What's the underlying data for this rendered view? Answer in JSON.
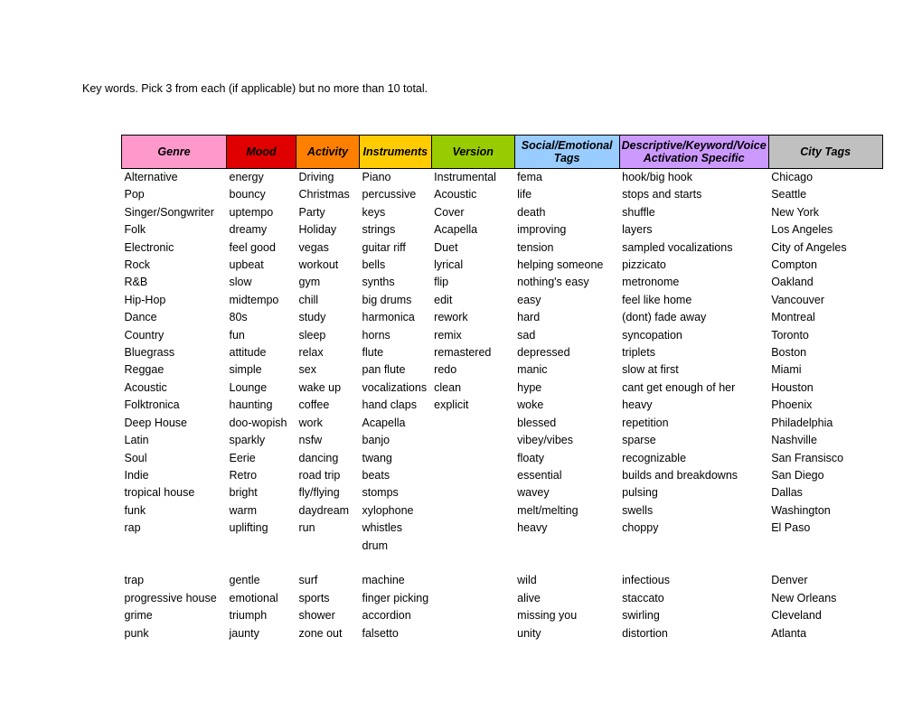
{
  "intro": {
    "text": "Key words. Pick 3 from each (if applicable) but no more than 10 total."
  },
  "table": {
    "headers": [
      {
        "label": "Genre",
        "color": "#FF99CC"
      },
      {
        "label": "Mood",
        "color": "#E00000"
      },
      {
        "label": "Activity",
        "color": "#FF8000"
      },
      {
        "label": "Instruments",
        "color": "#FFCC00"
      },
      {
        "label": "Version",
        "color": "#99CC00"
      },
      {
        "label": "Social/Emotional Tags",
        "color": "#99CCFF"
      },
      {
        "label": "Descriptive/Keyword/Voice Activation Specific",
        "color": "#CC99FF"
      },
      {
        "label": "City Tags",
        "color": "#C0C0C0"
      }
    ],
    "columns": {
      "genre": [
        "Alternative",
        "Pop",
        "Singer/Songwriter",
        "Folk",
        "Electronic",
        "Rock",
        "R&B",
        "Hip-Hop",
        "Dance",
        "Country",
        "Bluegrass",
        "Reggae",
        "Acoustic",
        "Folktronica",
        "Deep House",
        "Latin",
        "Soul",
        "Indie",
        "tropical house",
        "funk",
        "rap",
        "",
        "",
        "trap",
        "progressive house",
        "grime",
        "punk"
      ],
      "mood": [
        "energy",
        "bouncy",
        "uptempo",
        "dreamy",
        "feel good",
        "upbeat",
        "slow",
        "midtempo",
        "80s",
        "fun",
        "attitude",
        "simple",
        "Lounge",
        "haunting",
        "doo-wopish",
        "sparkly",
        "Eerie",
        "Retro",
        "bright",
        "warm",
        "uplifting",
        "",
        "",
        "gentle",
        "emotional",
        "triumph",
        "jaunty"
      ],
      "activity": [
        "Driving",
        "Christmas",
        "Party",
        "Holiday",
        "vegas",
        "workout",
        "gym",
        "chill",
        "study",
        "sleep",
        "relax",
        "sex",
        "wake up",
        "coffee",
        "work",
        "nsfw",
        "dancing",
        "road trip",
        "fly/flying",
        "daydream",
        "run",
        "",
        "",
        "surf",
        "sports",
        "shower",
        "zone out"
      ],
      "instruments": [
        "Piano",
        "percussive",
        "keys",
        "strings",
        "guitar riff",
        "bells",
        "synths",
        "big drums",
        "harmonica",
        "horns",
        "flute",
        "pan flute",
        "vocalizations",
        "hand claps",
        "Acapella",
        "banjo",
        "twang",
        "beats",
        "stomps",
        "xylophone",
        "whistles",
        "drum",
        "",
        "machine",
        "finger picking",
        "accordion",
        "falsetto"
      ],
      "version": [
        "Instrumental",
        "Acoustic",
        "Cover",
        "Acapella",
        "Duet",
        "lyrical",
        "flip",
        "edit",
        "rework",
        "remix",
        "remastered",
        "redo",
        "clean",
        "explicit",
        "",
        "",
        "",
        "",
        "",
        "",
        "",
        "",
        "",
        "",
        "",
        "",
        ""
      ],
      "social": [
        "fema",
        "life",
        "death",
        "improving",
        "tension",
        "helping someone",
        "nothing's easy",
        "easy",
        "hard",
        "sad",
        "depressed",
        "manic",
        "hype",
        "woke",
        "blessed",
        "vibey/vibes",
        "floaty",
        "essential",
        "wavey",
        "melt/melting",
        "heavy",
        "",
        "",
        "wild",
        "alive",
        "missing you",
        "unity"
      ],
      "descriptive": [
        "hook/big hook",
        "stops and starts",
        "shuffle",
        "layers",
        "sampled vocalizations",
        "pizzicato",
        "metronome",
        "feel like home",
        "(dont) fade away",
        "syncopation",
        "triplets",
        "slow at first",
        "cant get enough of her",
        "heavy",
        "repetition",
        "sparse",
        "recognizable",
        "builds and breakdowns",
        "pulsing",
        "swells",
        "choppy",
        "",
        "",
        "infectious",
        "staccato",
        "swirling",
        "distortion"
      ],
      "city": [
        "Chicago",
        "Seattle",
        "New York",
        "Los Angeles",
        "City of Angeles",
        "Compton",
        "Oakland",
        "Vancouver",
        "Montreal",
        "Toronto",
        "Boston",
        "Miami",
        "Houston",
        "Phoenix",
        "Philadelphia",
        "Nashville",
        "San Fransisco",
        "San Diego",
        "Dallas",
        "Washington",
        "El Paso",
        "",
        "",
        "Denver",
        "New Orleans",
        "Cleveland",
        "Atlanta"
      ]
    }
  }
}
